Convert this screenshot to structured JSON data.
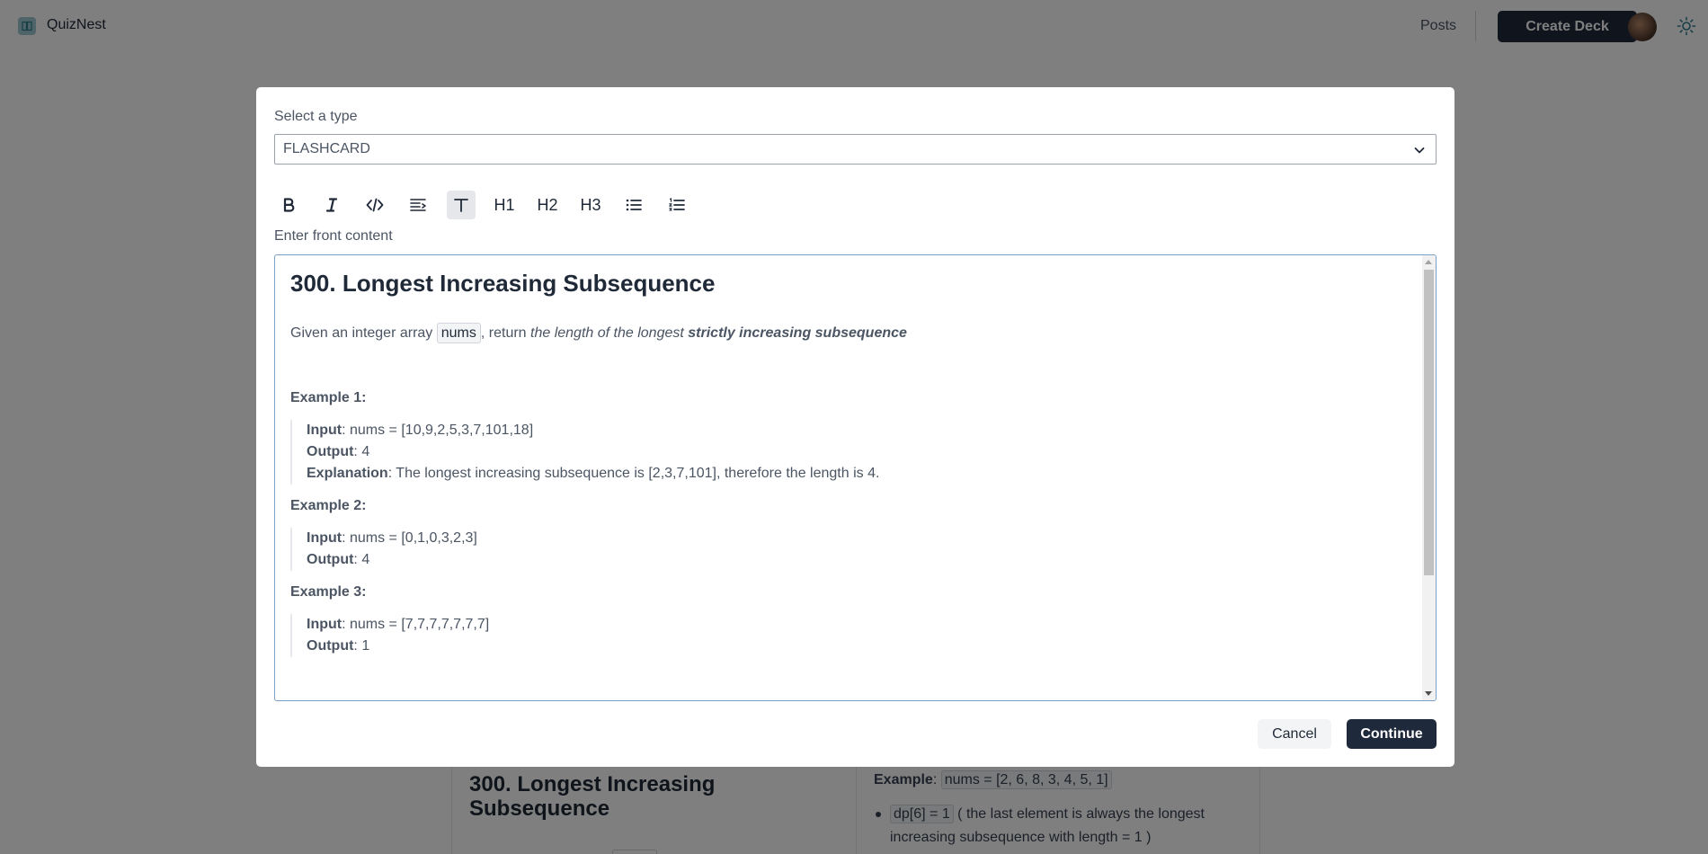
{
  "app": {
    "brand": "QuizNest",
    "nav_posts": "Posts",
    "create_deck": "Create Deck"
  },
  "background_card": {
    "title": "300. Longest Increasing Subsequence",
    "example_label": "Example",
    "example_code": "nums = [2, 6, 8, 3, 4, 5, 1]",
    "bullet_code": "dp[6] = 1",
    "bullet_text": "( the last element is always the longest increasing subsequence with length = 1 )"
  },
  "modal": {
    "type_label": "Select a type",
    "type_value": "FLASHCARD",
    "front_label": "Enter front content",
    "toolbar": {
      "h1": "H1",
      "h2": "H2",
      "h3": "H3"
    },
    "editor": {
      "title": "300. Longest Increasing Subsequence",
      "desc_pre": "Given an integer array ",
      "desc_code": "nums",
      "desc_mid": ", return ",
      "desc_italic": "the length of the longest ",
      "desc_bold_italic": "strictly increasing subsequence",
      "examples": [
        {
          "heading": "Example 1:",
          "lines": [
            {
              "label": "Input",
              "value": ": nums = [10,9,2,5,3,7,101,18]"
            },
            {
              "label": "Output",
              "value": ": 4"
            },
            {
              "label": "Explanation",
              "value": ": The longest increasing subsequence is [2,3,7,101], therefore the length is 4."
            }
          ]
        },
        {
          "heading": "Example 2:",
          "lines": [
            {
              "label": "Input",
              "value": ": nums = [0,1,0,3,2,3]"
            },
            {
              "label": "Output",
              "value": ": 4"
            }
          ]
        },
        {
          "heading": "Example 3:",
          "lines": [
            {
              "label": "Input",
              "value": ": nums = [7,7,7,7,7,7,7]"
            },
            {
              "label": "Output",
              "value": ": 1"
            }
          ]
        }
      ]
    },
    "cancel": "Cancel",
    "continue": "Continue"
  },
  "colors": {
    "primary_button": "#1e293b",
    "overlay": "rgba(0,0,0,0.5)",
    "editor_border": "#7aa0c8"
  }
}
